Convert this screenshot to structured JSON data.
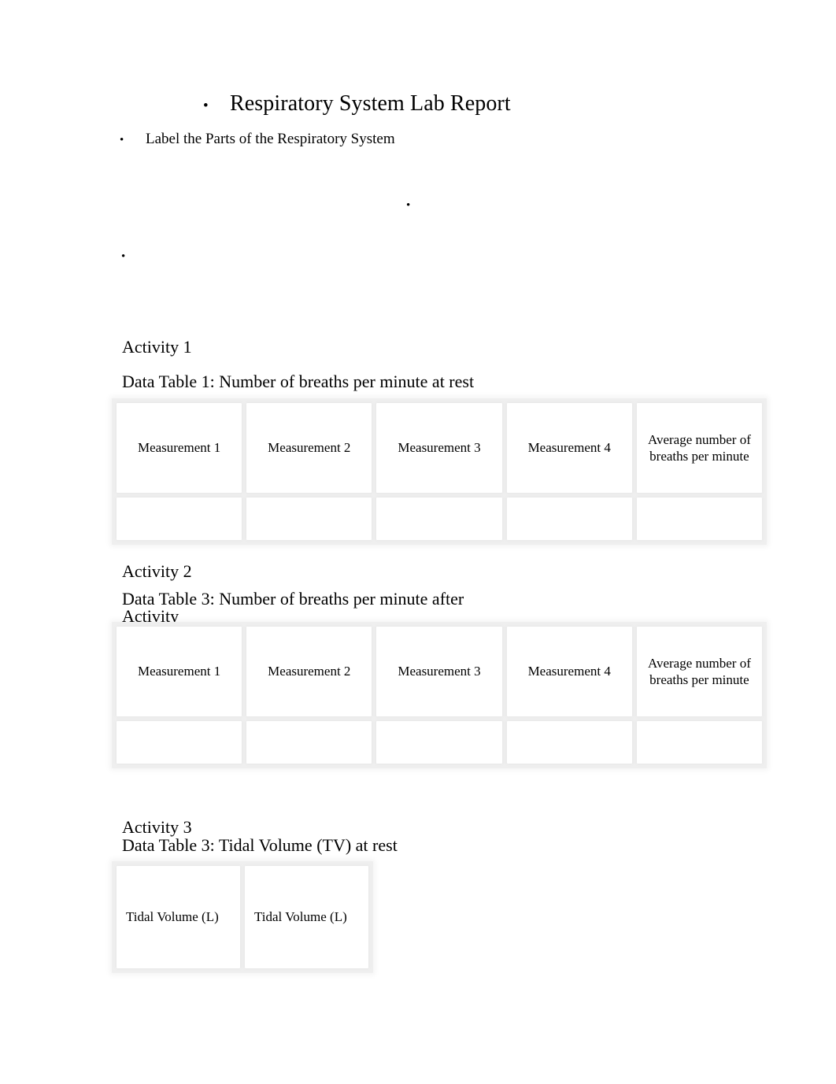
{
  "document": {
    "title": "Respiratory System Lab Report",
    "title_bullet": "•",
    "subtitle": "Label the Parts of the Respiratory System",
    "subtitle_bullet": "•",
    "placeholder_bullets": [
      {
        "glyph": "•",
        "name": "empty-bullet-centered"
      },
      {
        "glyph": "•",
        "name": "empty-bullet-left"
      }
    ]
  },
  "activity1": {
    "heading": "Activity 1",
    "table_caption": "Data Table 1: Number of breaths per minute at rest",
    "table": {
      "headers": [
        "Measurement 1",
        "Measurement 2",
        "Measurement 3",
        "Measurement 4",
        "Average number of breaths per minute"
      ],
      "rows": [
        [
          "",
          "",
          "",
          "",
          ""
        ]
      ]
    }
  },
  "activity2": {
    "heading": "Activity 2",
    "table_caption": "Data Table 3: Number of breaths per minute after Activity",
    "table": {
      "headers": [
        "Measurement 1",
        "Measurement 2",
        "Measurement 3",
        "Measurement 4",
        "Average number of breaths per minute"
      ],
      "rows": [
        [
          "",
          "",
          "",
          "",
          ""
        ]
      ]
    }
  },
  "activity3": {
    "heading": "Activity 3",
    "table_caption": "Data Table 3: Tidal Volume (TV) at rest",
    "table": {
      "headers": [
        "Tidal Volume (L)",
        "Tidal Volume (L)"
      ],
      "rows": []
    }
  }
}
